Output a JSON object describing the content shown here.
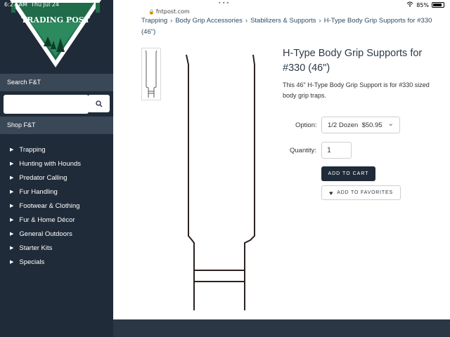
{
  "status_bar": {
    "time": "6:27 AM",
    "date": "Thu Jul 24",
    "url": "fntpost.com",
    "battery": "85%",
    "battery_level": 0.85
  },
  "logo": {
    "text": "TRADING POST",
    "alt": "Fur & Trapper Trading Post logo"
  },
  "sidebar": {
    "search_header": "Search F&T",
    "search_placeholder": "",
    "shop_header": "Shop F&T",
    "items": [
      {
        "label": "Trapping"
      },
      {
        "label": "Hunting with Hounds"
      },
      {
        "label": "Predator Calling"
      },
      {
        "label": "Fur Handling"
      },
      {
        "label": "Footwear & Clothing"
      },
      {
        "label": "Fur & Home Décor"
      },
      {
        "label": "General Outdoors"
      },
      {
        "label": "Starter Kits"
      },
      {
        "label": "Specials"
      }
    ]
  },
  "breadcrumb": [
    "Trapping",
    "Body Grip Accessories",
    "Stabilizers & Supports",
    "H-Type Body Grip Supports for #330 (46\")"
  ],
  "product": {
    "title": "H-Type Body Grip Supports for #330 (46\")",
    "description": "This 46\" H-Type Body Grip Support is for #330 sized body grip traps.",
    "option_label": "Option:",
    "option_value": "1/2 Dozen  $50.95",
    "quantity_label": "Quantity:",
    "quantity_value": "1",
    "add_to_cart": "ADD TO CART",
    "add_to_favorites": "ADD TO FAVORITES"
  },
  "colors": {
    "sidebar_bg": "#1f2b38",
    "section_header_bg": "#3a4756",
    "logo_green": "#1f6b4a",
    "button_dark": "#1f2b38"
  }
}
